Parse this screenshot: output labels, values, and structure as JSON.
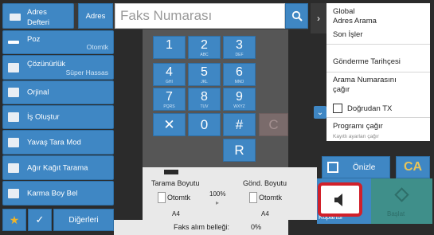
{
  "address_book": {
    "label_line1": "Adres",
    "label_line2": "Defteri"
  },
  "address_button": "Adres",
  "fax_number_placeholder": "Faks Numarası",
  "left_menu": [
    {
      "label": "Poz",
      "value": "Otomtk"
    },
    {
      "label": "Çözünürlük",
      "value": "Süper Hassas"
    },
    {
      "label": "Orjinal",
      "value": ""
    },
    {
      "label": "İş Oluştur",
      "value": ""
    },
    {
      "label": "Yavaş Tara Mod",
      "value": ""
    },
    {
      "label": "Ağır Kağıt Tarama",
      "value": ""
    },
    {
      "label": "Karma Boy Bel",
      "value": ""
    }
  ],
  "bottom_left": {
    "others_label": "Diğerleri"
  },
  "keypad": [
    {
      "num": "1",
      "sub": ""
    },
    {
      "num": "2",
      "sub": "ABC"
    },
    {
      "num": "3",
      "sub": "DEF"
    },
    {
      "num": "4",
      "sub": "GHI"
    },
    {
      "num": "5",
      "sub": "JKL"
    },
    {
      "num": "6",
      "sub": "MNO"
    },
    {
      "num": "7",
      "sub": "PQRS"
    },
    {
      "num": "8",
      "sub": "TUV"
    },
    {
      "num": "9",
      "sub": "WXYZ"
    },
    {
      "num": "✕",
      "sub": ""
    },
    {
      "num": "0",
      "sub": ""
    },
    {
      "num": "#",
      "sub": ""
    },
    {
      "num": "C",
      "sub": ""
    },
    {
      "num": "R",
      "sub": ""
    }
  ],
  "right_panel": {
    "global_address_search": {
      "line1": "Global",
      "line2": "Adres Arama"
    },
    "recent_jobs": "Son İşler",
    "send_history": "Gönderme Tarihçesi",
    "call_number": {
      "line1": "Arama Numarasını",
      "line2": "çağır"
    },
    "direct_tx": "Doğrudan TX",
    "recall_program": "Programı çağır",
    "recall_settings_hint": "Kayıtlı ayarları çağır"
  },
  "status": {
    "scan_size_label": "Tarama Boyutu",
    "scan_size_value": "Otomtk",
    "scan_paper": "A4",
    "ratio": "100%",
    "send_size_label": "Gönd. Boyutu",
    "send_size_value": "Otomtk",
    "send_paper": "A4"
  },
  "footer": {
    "memory_label": "Faks alım belleği:",
    "memory_value": "0%"
  },
  "actions": {
    "preview": "Önizle",
    "ca": "CA",
    "start_partial": "Kopartul",
    "start": "Başlat"
  }
}
